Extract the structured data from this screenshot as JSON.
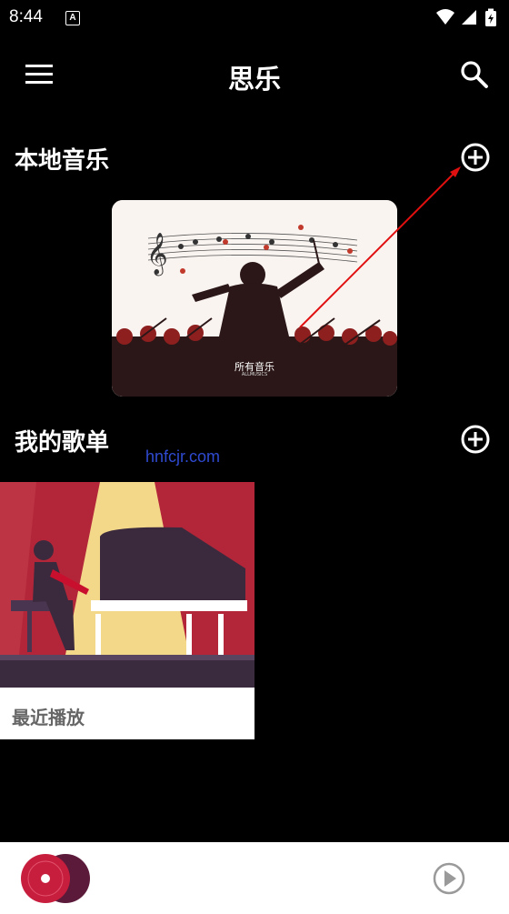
{
  "status_bar": {
    "time": "8:44",
    "notification_letter": "A"
  },
  "app_bar": {
    "title": "思乐"
  },
  "local_music": {
    "title": "本地音乐",
    "card": {
      "title": "所有音乐",
      "subtitle": "ALLMUSICS"
    }
  },
  "my_playlists": {
    "title": "我的歌单",
    "items": [
      {
        "name": "最近播放"
      }
    ]
  },
  "watermark": "hnfcjr.com",
  "colors": {
    "background": "#000000",
    "accent_red": "#c8102e",
    "stage_red": "#b3263a",
    "spotlight": "#f4d88a"
  },
  "icons": [
    "menu-icon",
    "search-icon",
    "add-circle-icon",
    "play-circle-icon",
    "wifi-icon",
    "signal-icon",
    "battery-icon"
  ]
}
